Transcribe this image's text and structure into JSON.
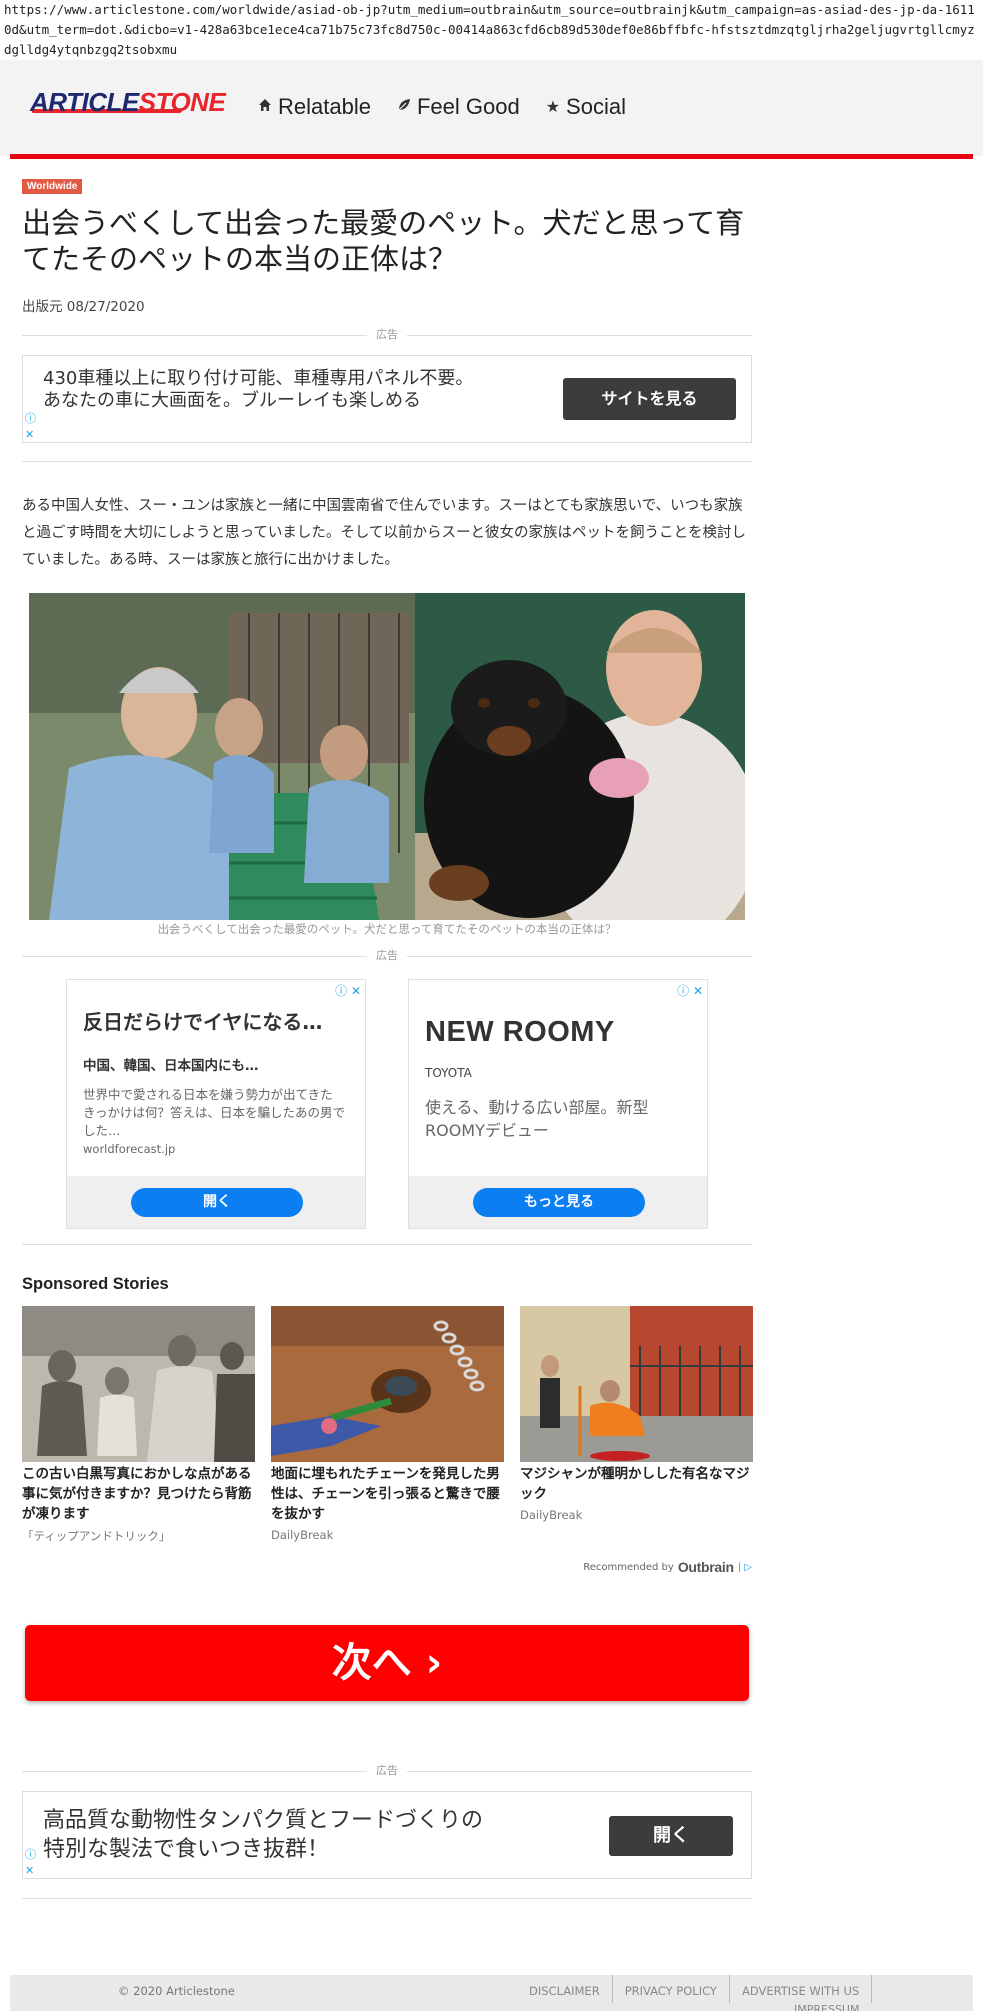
{
  "browser": {
    "url": "https://www.articlestone.com/worldwide/asiad-ob-jp?utm_medium=outbrain&utm_source=outbrainjk&utm_campaign=as-asiad-des-jp-da-16110d&utm_term=dot.&dicbo=v1-428a63bce1ece4ca71b75c73fc8d750c-00414a863cfd6cb89d530def0e86bffbfc-hfstsztdmzqtgljrha2geljugvrtgllcmyzdglldg4ytqnbzgq2tsobxmu"
  },
  "header": {
    "logo_part1": "ARTICLE",
    "logo_part2": "STONE",
    "nav": [
      {
        "label": "Relatable",
        "icon": "home-icon"
      },
      {
        "label": "Feel Good",
        "icon": "leaf-icon"
      },
      {
        "label": "Social",
        "icon": "star-icon"
      }
    ]
  },
  "article": {
    "category": "Worldwide",
    "title": "出会うべくして出会った最愛のペット。犬だと思って育てたそのペットの本当の正体は？",
    "published": "出版元 08/27/2020",
    "body": "ある中国人女性、スー・ユンは家族と一緒に中国雲南省で住んでいます。スーはとても家族思いで、いつも家族と過ごす時間を大切にしようと思っていました。そして以前からスーと彼女の家族はペットを飼うことを検討していました。ある時、スーは家族と旅行に出かけました。",
    "image_caption": "出会うべくして出会った最愛のペット。犬だと思って育てたそのペットの本当の正体は？"
  },
  "ads": {
    "label": "広告",
    "top_banner": {
      "text_line1": "430車種以上に取り付け可能、車種専用パネル不要。",
      "text_line2": "あなたの車に大画面を。ブルーレイも楽しめる",
      "button": "サイトを見る"
    },
    "cards": [
      {
        "title": "反日だらけでイヤになる…",
        "subtitle": "中国、韓国、日本国内にも…",
        "desc": "世界中で愛される日本を嫌う勢力が出てきたきっかけは何？答えは、日本を騙したあの男でした…",
        "domain": "worldforecast.jp",
        "cta": "開く"
      },
      {
        "title": "NEW ROOMY",
        "brand": "TOYOTA",
        "desc": "使える、動ける広い部屋。新型ROOMYデビュー",
        "cta": "もっと見る"
      }
    ],
    "bottom_banner": {
      "text_line1": "高品質な動物性タンパク質とフードづくりの",
      "text_line2": "特別な製法で食いつき抜群！",
      "button": "開く"
    },
    "adchoice_i": "ⓘ",
    "adchoice_x": "✕",
    "adchoice_ix": "ⓘ ✕"
  },
  "sponsored": {
    "title": "Sponsored Stories",
    "stories": [
      {
        "headline": "この古い白黒写真におかしな点がある事に気が付きますか？見つけたら背筋が凍ります",
        "source": "「ティップアンドトリック」"
      },
      {
        "headline": "地面に埋もれたチェーンを発見した男性は、チェーンを引っ張ると驚きで腰を抜かす",
        "source": "DailyBreak"
      },
      {
        "headline": "マジシャンが種明かしした有名なマジック",
        "source": "DailyBreak"
      }
    ],
    "recommended_by": "Recommended by",
    "outbrain": "Outbrain"
  },
  "next_button": "次へ ›",
  "footer": {
    "copyright": "© 2020 Articlestone",
    "links": [
      "DISCLAIMER",
      "PRIVACY POLICY",
      "ADVERTISE WITH US"
    ],
    "impressum": "IMPRESSUM"
  }
}
